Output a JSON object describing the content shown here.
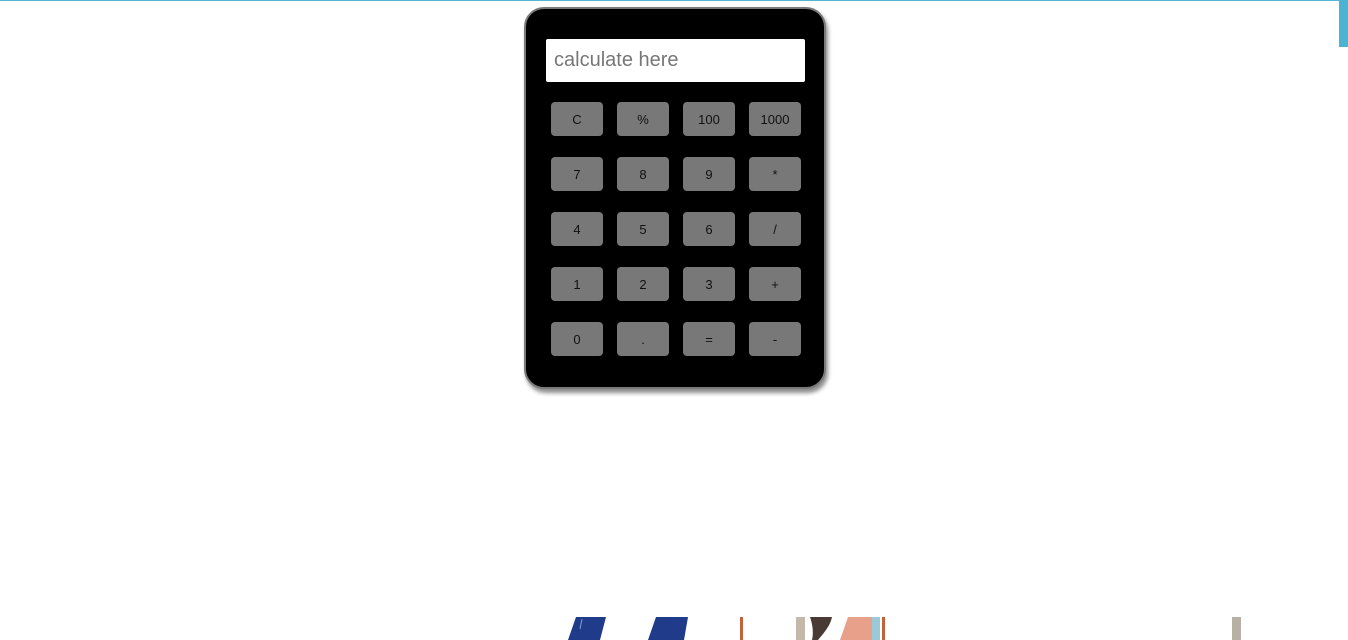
{
  "calculator": {
    "display_placeholder": "calculate here",
    "keys": [
      "C",
      "%",
      "100",
      "1000",
      "7",
      "8",
      "9",
      "*",
      "4",
      "5",
      "6",
      "/",
      "1",
      "2",
      "3",
      "+",
      "0",
      ".",
      "=",
      "-"
    ]
  },
  "colors": {
    "accent": "#4cb3d3",
    "calculator_body": "#000000",
    "key_background": "#787878"
  }
}
